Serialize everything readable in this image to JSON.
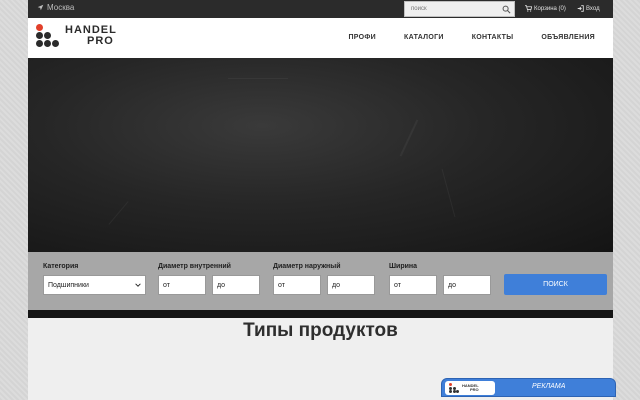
{
  "topbar": {
    "city": "Москва",
    "search_placeholder": "поиск",
    "cart": "Корзина (0)",
    "login": "Вход"
  },
  "logo": {
    "line1": "HANDEL",
    "line2": "PRO"
  },
  "menu": [
    "ПРОФИ",
    "КАТАЛОГИ",
    "КОНТАКТЫ",
    "ОБЪЯВЛЕНИЯ"
  ],
  "filters": {
    "category_label": "Категория",
    "category_value": "Подшипники",
    "inner_label": "Диаметр внутренний",
    "outer_label": "Диаметр наружный",
    "width_label": "Ширина",
    "from": "от",
    "to": "до",
    "search_button": "ПОИСК"
  },
  "content": {
    "title": "Типы продуктов"
  },
  "ad": {
    "logo_line1": "HANDEL",
    "logo_line2": "PRO",
    "label": "РЕКЛАМА"
  },
  "colors": {
    "accent": "#3f7fd9",
    "topbar": "#2b2b2b",
    "filter_bar": "#a7a7a7"
  }
}
